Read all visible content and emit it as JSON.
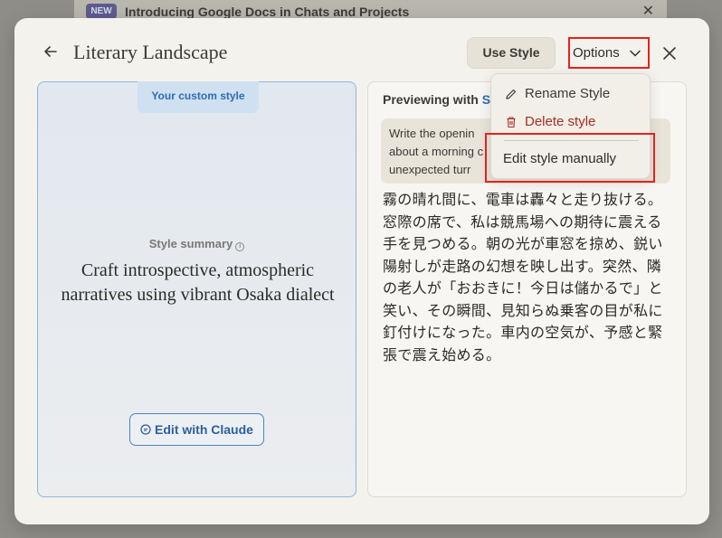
{
  "banner": {
    "badge": "NEW",
    "text": "Introducing Google Docs in Chats and Projects"
  },
  "modal": {
    "title": "Literary Landscape",
    "use_style_label": "Use Style",
    "options_label": "Options"
  },
  "left_panel": {
    "tag": "Your custom style",
    "summary_label": "Style summary",
    "summary_text": "Craft introspective, atmospheric narratives using vibrant Osaka dialect",
    "edit_button_label": "Edit with Claude"
  },
  "right_panel": {
    "preview_prefix": "Previewing with ",
    "preview_style_partial": "S",
    "prompt_line1": "Write the openin",
    "prompt_line2": "about a morning c",
    "prompt_line3": "unexpected turr",
    "response_text": "霧の晴れ間に、電車は轟々と走り抜ける。窓際の席で、私は競馬場への期待に震える手を見つめる。朝の光が車窓を掠め、鋭い陽射しが走路の幻想を映し出す。突然、隣の老人が「おおきに！今日は儲かるで」と笑い、その瞬間、見知らぬ乗客の目が私に釘付けになった。車内の空気が、予感と緊張で震え始める。"
  },
  "dropdown": {
    "rename_label": "Rename Style",
    "delete_label": "Delete style",
    "edit_manual_label": "Edit style manually"
  },
  "colors": {
    "accent_red": "#e8211b",
    "link_blue": "#2f6cb4",
    "delete_red": "#a92c23"
  }
}
